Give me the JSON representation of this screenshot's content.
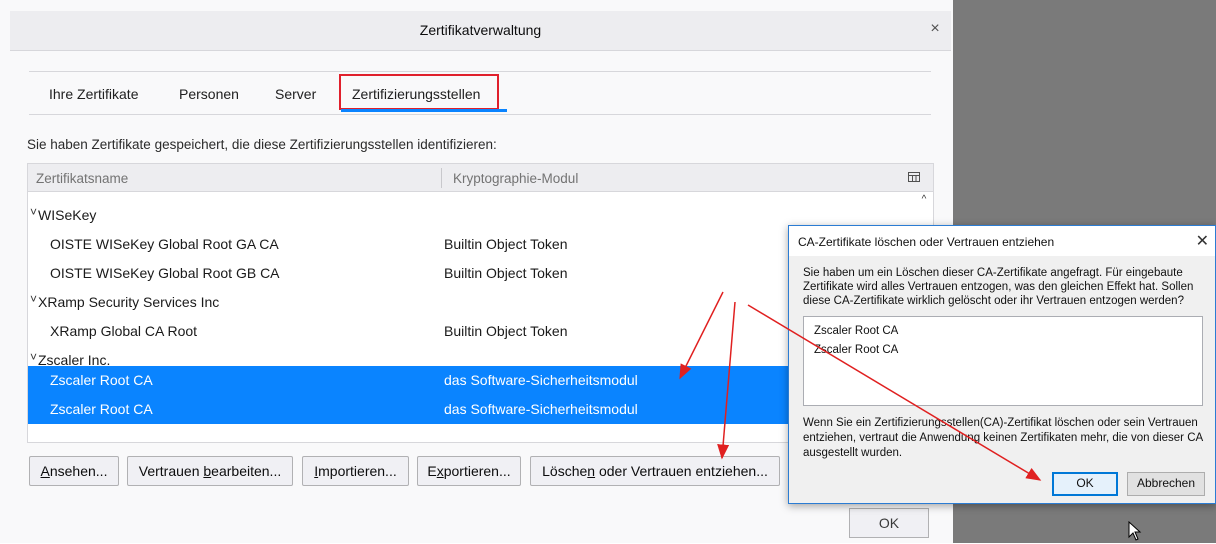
{
  "main_dialog": {
    "title": "Zertifikatverwaltung",
    "close_glyph": "×",
    "tabs": [
      "Ihre Zertifikate",
      "Personen",
      "Server",
      "Zertifizierungsstellen"
    ],
    "selected_tab": "Zertifizierungsstellen",
    "intro_text": "Sie haben Zertifikate gespeichert, die diese Zertifizierungsstellen identifizieren:",
    "columns": [
      "Zertifikatsname",
      "Kryptographie-Modul"
    ],
    "rows": [
      {
        "type": "group",
        "name": "WISeKey",
        "module": ""
      },
      {
        "type": "item",
        "name": "OISTE WISeKey Global Root GA CA",
        "module": "Builtin Object Token"
      },
      {
        "type": "item",
        "name": "OISTE WISeKey Global Root GB CA",
        "module": "Builtin Object Token"
      },
      {
        "type": "group",
        "name": "XRamp Security Services Inc",
        "module": ""
      },
      {
        "type": "item",
        "name": "XRamp Global CA Root",
        "module": "Builtin Object Token"
      },
      {
        "type": "group",
        "name": "Zscaler Inc.",
        "module": ""
      },
      {
        "type": "item",
        "name": "Zscaler Root CA",
        "module": "das Software-Sicherheitsmodul",
        "selected": true
      },
      {
        "type": "item",
        "name": "Zscaler Root CA",
        "module": "das Software-Sicherheitsmodul",
        "selected": true
      }
    ],
    "buttons": {
      "view": {
        "pre": "",
        "u": "A",
        "post": "nsehen..."
      },
      "edit_trust": {
        "pre": "Vertrauen ",
        "u": "b",
        "post": "earbeiten..."
      },
      "import": {
        "pre": "",
        "u": "I",
        "post": "mportieren..."
      },
      "export": {
        "pre": "E",
        "u": "x",
        "post": "portieren..."
      },
      "delete": {
        "pre": "Lösche",
        "u": "n",
        "post": " oder Vertrauen entziehen..."
      }
    },
    "ok_label": "OK"
  },
  "confirm_dialog": {
    "title": "CA-Zertifikate löschen oder Vertrauen entziehen",
    "close_glyph": "✕",
    "message": "Sie haben um ein Löschen dieser CA-Zertifikate angefragt. Für eingebaute Zertifikate wird alles Vertrauen entzogen, was den gleichen Effekt hat. Sollen diese CA-Zertifikate wirklich gelöscht oder ihr Vertrauen entzogen werden?",
    "list_items": [
      "Zscaler Root CA",
      "Zscaler Root CA"
    ],
    "warning": "Wenn Sie ein Zertifizierungsstellen(CA)-Zertifikat löschen oder sein Vertrauen entziehen, vertraut die Anwendung keinen Zertifikaten mehr, die von dieser CA ausgestellt wurden.",
    "ok_label": "OK",
    "cancel_label": "Abbrechen"
  },
  "colors": {
    "selection": "#0a84ff",
    "highlight_box": "#e0202c",
    "annotation_arrow": "#e02020",
    "tab_underline": "#0a84ff"
  },
  "icons": [
    "column-picker-icon",
    "twisty-open-icon",
    "scroll-up-icon",
    "close-icon",
    "mouse-cursor-icon"
  ]
}
